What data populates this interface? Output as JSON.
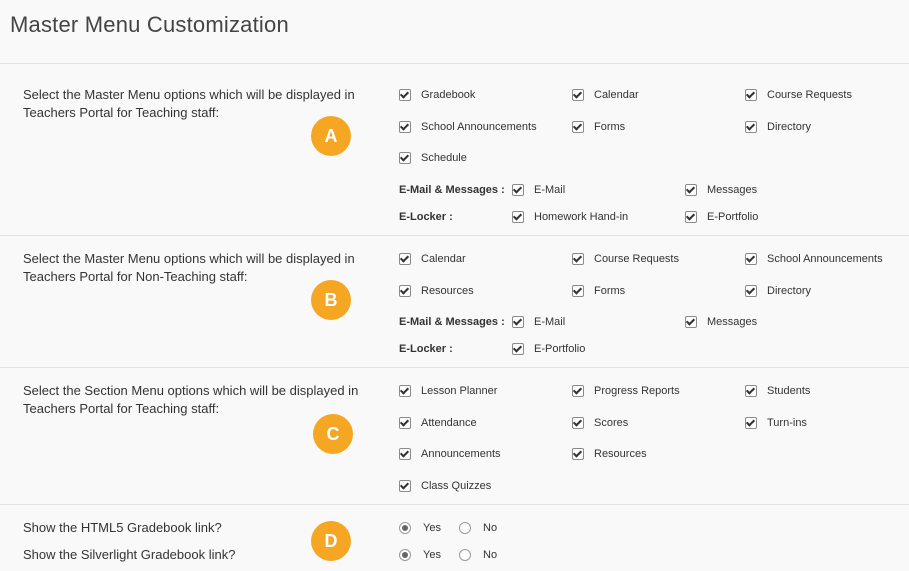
{
  "page": {
    "title": "Master Menu Customization"
  },
  "theme": {
    "accent": "#f5a623",
    "divider": "#e2e2e2",
    "background": "#f9f9f9"
  },
  "section_a": {
    "badge": "A",
    "desc_line1": "Select the Master Menu options which will be displayed in",
    "desc_line2": "Teachers Portal for Teaching staff:",
    "options": [
      "Gradebook",
      "Calendar",
      "Course Requests",
      "School Announcements",
      "Forms",
      "Directory",
      "Schedule"
    ],
    "email_label": "E-Mail & Messages :",
    "email_options": [
      "E-Mail",
      "Messages"
    ],
    "elocker_label": "E-Locker :",
    "elocker_options": [
      "Homework Hand-in",
      "E-Portfolio"
    ]
  },
  "section_b": {
    "badge": "B",
    "desc_line1": "Select the Master Menu options which will be displayed in",
    "desc_line2": "Teachers Portal for Non-Teaching staff:",
    "options": [
      "Calendar",
      "Course Requests",
      "School Announcements",
      "Resources",
      "Forms",
      "Directory"
    ],
    "email_label": "E-Mail & Messages :",
    "email_options": [
      "E-Mail",
      "Messages"
    ],
    "elocker_label": "E-Locker :",
    "elocker_options": [
      "E-Portfolio"
    ]
  },
  "section_c": {
    "badge": "C",
    "desc_line1": "Select the Section Menu options which will be displayed in",
    "desc_line2": "Teachers Portal for Teaching staff:",
    "options": [
      "Lesson Planner",
      "Progress Reports",
      "Students",
      "Attendance",
      "Scores",
      "Turn-ins",
      "Announcements",
      "Resources",
      "Class Quizzes"
    ]
  },
  "section_d": {
    "badge": "D",
    "html5_question": "Show the HTML5 Gradebook link?",
    "silverlight_question": "Show the Silverlight Gradebook link?",
    "yes_label": "Yes",
    "no_label": "No"
  }
}
